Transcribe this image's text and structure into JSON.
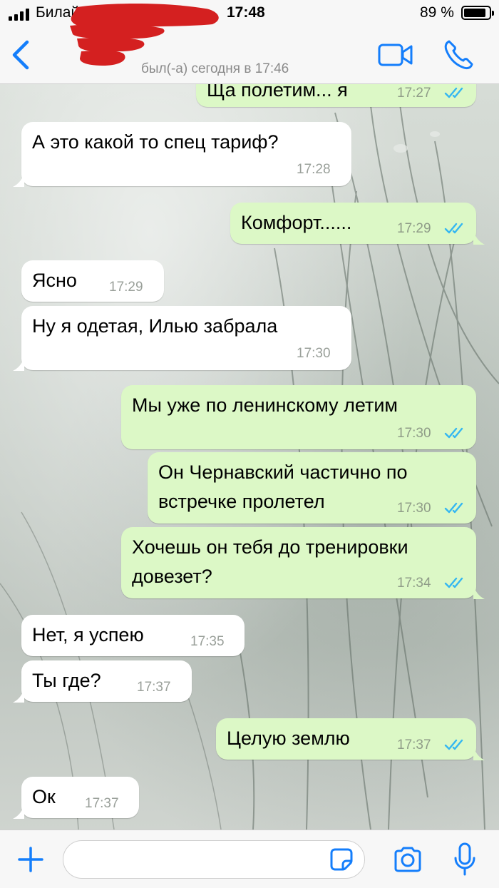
{
  "status_bar": {
    "carrier": "Билайн LTE",
    "time": "17:48",
    "battery_percent": "89 %",
    "battery_level": 0.89
  },
  "header": {
    "last_seen": "был(-а) сегодня в 17:46"
  },
  "colors": {
    "accent": "#147efb",
    "incoming_bubble": "#ffffff",
    "outgoing_bubble": "#dcf8c6",
    "read_ticks": "#34b7f1",
    "redaction": "#d42020"
  },
  "messages": [
    {
      "direction": "out",
      "text": "Ща полетим... я",
      "time": "17:27",
      "read": true
    },
    {
      "direction": "in",
      "text": "А это какой то спец тариф?",
      "time": "17:28"
    },
    {
      "direction": "out",
      "text": "Комфорт......",
      "time": "17:29",
      "read": true
    },
    {
      "direction": "in",
      "text": "Ясно",
      "time": "17:29"
    },
    {
      "direction": "in",
      "text": "Ну я одетая, Илью забрала",
      "time": "17:30"
    },
    {
      "direction": "out",
      "text": "Мы уже по ленинскому летим",
      "time": "17:30",
      "read": true
    },
    {
      "direction": "out",
      "text": "Он Чернавский частично по\nвстречке пролетел",
      "time": "17:30",
      "read": true
    },
    {
      "direction": "out",
      "text": "Хочешь он тебя до тренировки\nдовезет?",
      "time": "17:34",
      "read": true
    },
    {
      "direction": "in",
      "text": "Нет, я успею",
      "time": "17:35"
    },
    {
      "direction": "in",
      "text": "Ты где?",
      "time": "17:37"
    },
    {
      "direction": "out",
      "text": "Целую землю",
      "time": "17:37",
      "read": true
    },
    {
      "direction": "in",
      "text": "Ок",
      "time": "17:37"
    }
  ],
  "input": {
    "value": "",
    "placeholder": ""
  },
  "icons": {
    "back": "chevron-left-icon",
    "video": "video-camera-icon",
    "call": "phone-icon",
    "add": "plus-icon",
    "sticker": "sticker-icon",
    "camera": "camera-icon",
    "mic": "microphone-icon"
  }
}
